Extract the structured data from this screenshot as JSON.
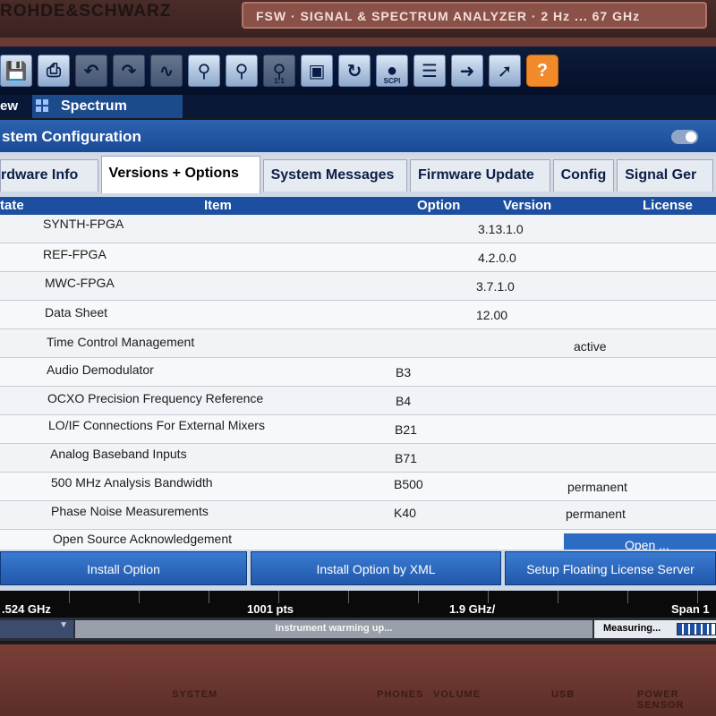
{
  "hardware": {
    "brand": "ROHDE&SCHWARZ",
    "model_plate": "FSW · SIGNAL & SPECTRUM ANALYZER · 2 Hz ... 67 GHz",
    "labels": [
      "SYSTEM",
      "PHONES",
      "VOLUME",
      "USB",
      "POWER SENSOR"
    ]
  },
  "toolbar": {
    "icons": [
      "save-icon",
      "print-icon",
      "undo-icon",
      "redo-icon",
      "zoom-icon",
      "zoom-area-icon",
      "multi-zoom-icon",
      "zoom-1to1-icon",
      "fullscreen-icon",
      "refresh-icon",
      "scpi-icon",
      "sequencer-icon",
      "display-icon",
      "help-pointer-icon",
      "help-icon"
    ],
    "scpi_label": "SCPI",
    "zoom_label": "1:1",
    "help_label": "?"
  },
  "tabs_top": {
    "overview": "ew",
    "spectrum": "Spectrum"
  },
  "dialog": {
    "title": "stem Configuration",
    "tabs": [
      "rdware Info",
      "Versions + Options",
      "System Messages",
      "Firmware Update",
      "Config",
      "Signal Ger"
    ],
    "active_tab": "Versions + Options"
  },
  "table": {
    "headers": {
      "state": "tate",
      "item": "Item",
      "option": "Option",
      "version": "Version",
      "license": "License"
    },
    "rows": [
      {
        "item": "SYNTH-FPGA",
        "option": "",
        "version": "3.13.1.0",
        "license": ""
      },
      {
        "item": "REF-FPGA",
        "option": "",
        "version": "4.2.0.0",
        "license": ""
      },
      {
        "item": "MWC-FPGA",
        "option": "",
        "version": "3.7.1.0",
        "license": ""
      },
      {
        "item": "Data Sheet",
        "option": "",
        "version": "12.00",
        "license": ""
      },
      {
        "item": "Time Control Management",
        "option": "",
        "version": "",
        "license": "active"
      },
      {
        "item": "Audio Demodulator",
        "option": "B3",
        "version": "",
        "license": ""
      },
      {
        "item": "OCXO Precision Frequency Reference",
        "option": "B4",
        "version": "",
        "license": ""
      },
      {
        "item": "LO/IF Connections For External Mixers",
        "option": "B21",
        "version": "",
        "license": ""
      },
      {
        "item": "Analog Baseband Inputs",
        "option": "B71",
        "version": "",
        "license": ""
      },
      {
        "item": "500 MHz Analysis Bandwidth",
        "option": "B500",
        "version": "",
        "license": "permanent"
      },
      {
        "item": "Phase Noise Measurements",
        "option": "K40",
        "version": "",
        "license": "permanent"
      },
      {
        "item": "Open Source Acknowledgement",
        "option": "",
        "version": "",
        "license": ""
      }
    ],
    "open_button": "Open ..."
  },
  "buttons": {
    "install_option": "Install Option",
    "install_xml": "Install Option by XML",
    "floating_license": "Setup Floating License Server"
  },
  "measurement": {
    "start_freq": ".524 GHz",
    "points": "1001 pts",
    "div": "1.9 GHz/",
    "span": "Span 1"
  },
  "status": {
    "message": "Instrument warming up...",
    "measuring": "Measuring...",
    "progress_fraction": 0.9
  },
  "colors": {
    "accent": "#1d4fa0",
    "title_bar": "#2c62b0",
    "help_orange": "#f08a2a"
  }
}
